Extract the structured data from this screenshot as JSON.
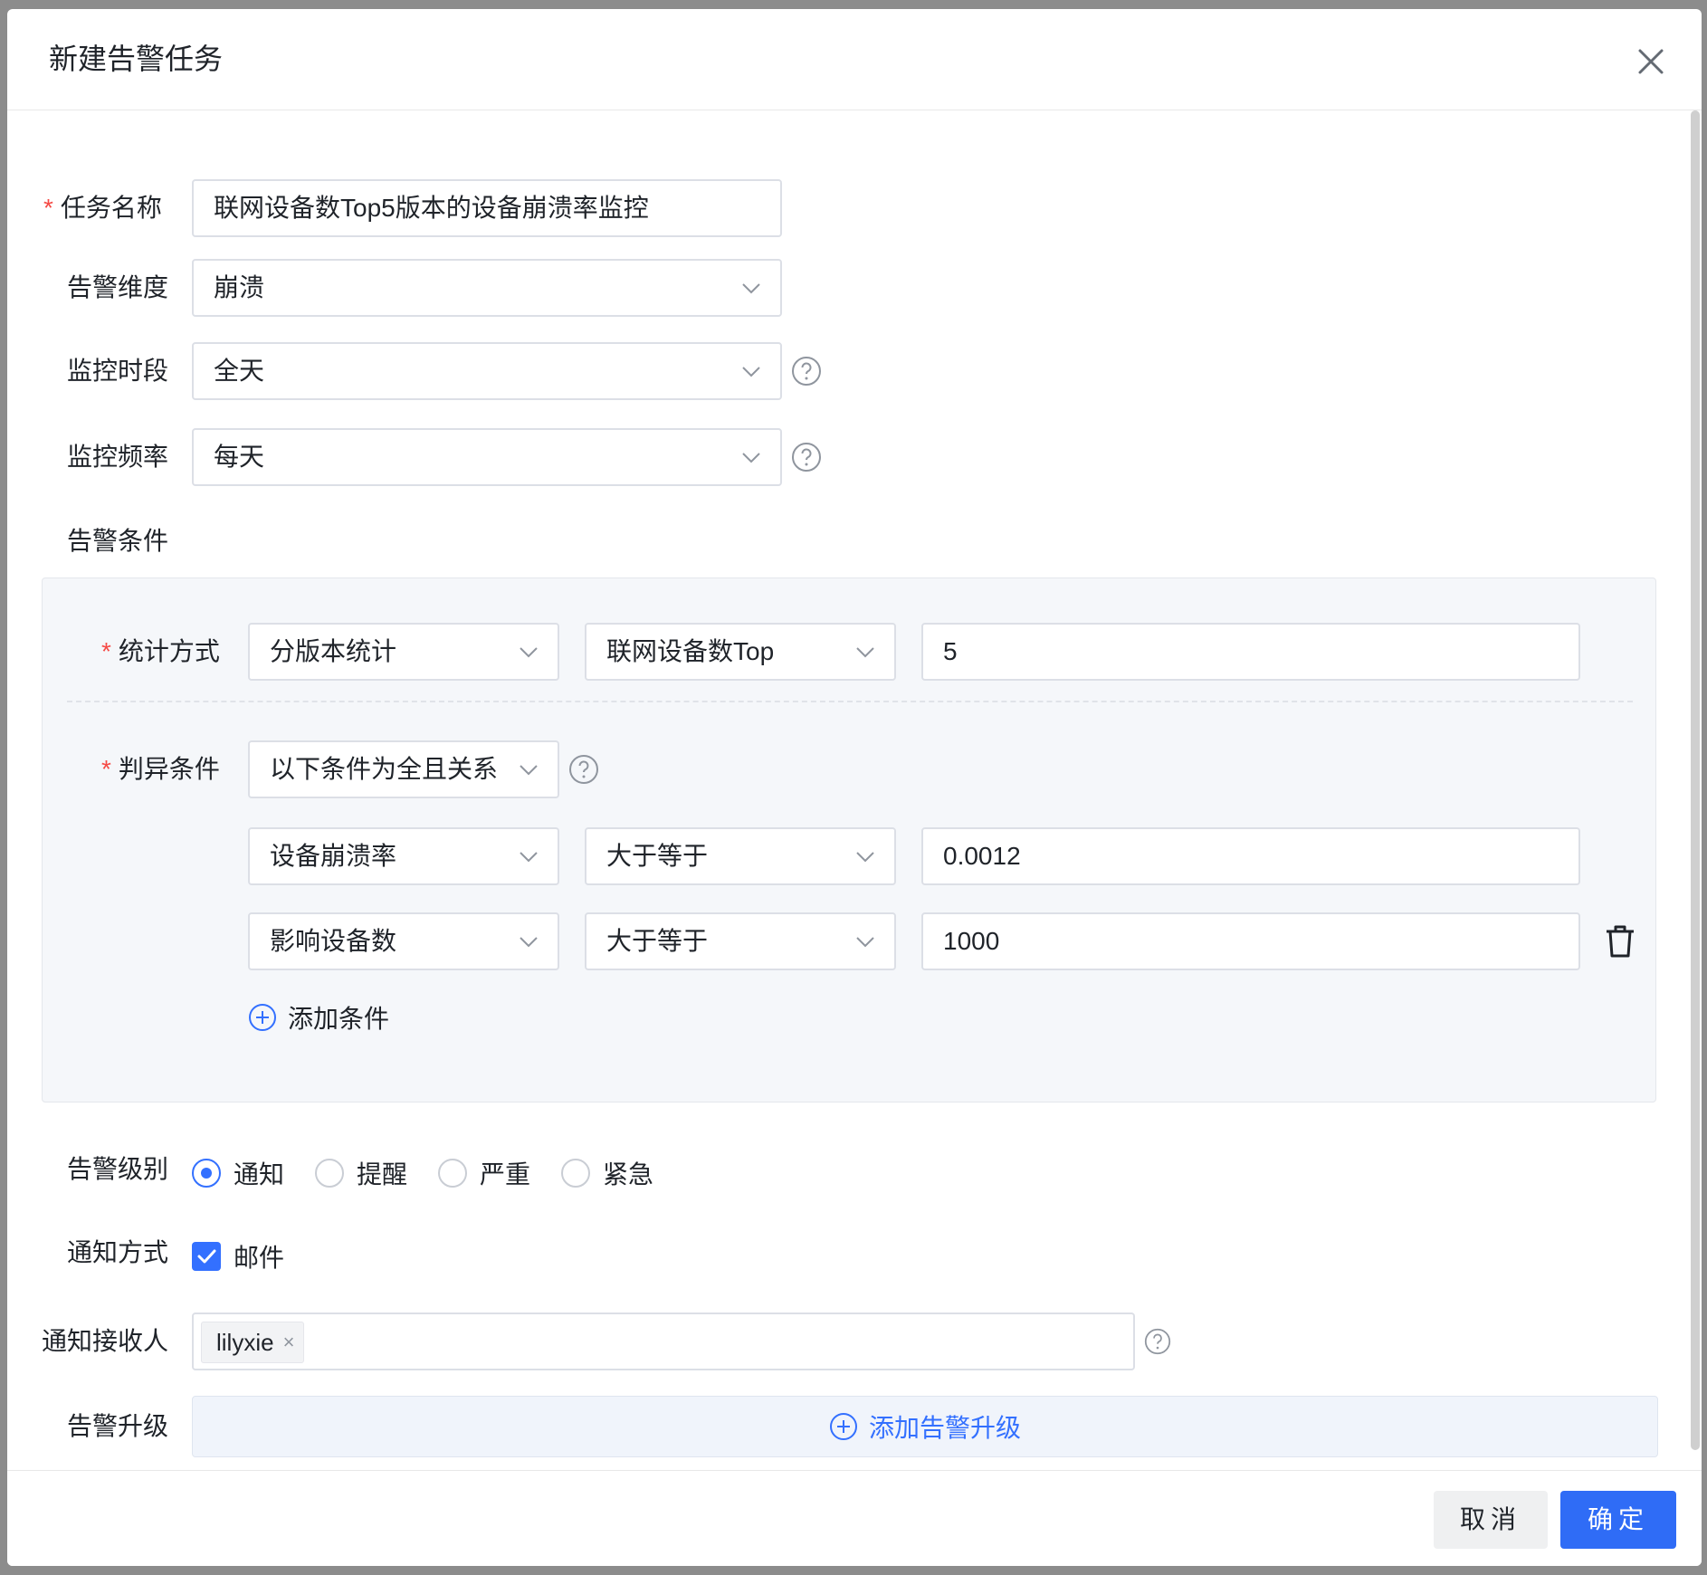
{
  "dialog": {
    "title": "新建告警任务"
  },
  "form": {
    "task_name": {
      "label": "任务名称",
      "required_mark": "*",
      "value": "联网设备数Top5版本的设备崩溃率监控"
    },
    "alert_dimension": {
      "label": "告警维度",
      "value": "崩溃"
    },
    "monitor_period": {
      "label": "监控时段",
      "value": "全天"
    },
    "monitor_frequency": {
      "label": "监控频率",
      "value": "每天"
    },
    "alert_condition": {
      "label": "告警条件",
      "stat_method": {
        "label": "统计方式",
        "required_mark": "*",
        "method": "分版本统计",
        "rank_by": "联网设备数Top",
        "top_n": "5"
      },
      "judge": {
        "label": "判异条件",
        "required_mark": "*",
        "relation": "以下条件为全且关系"
      },
      "rules": [
        {
          "metric": "设备崩溃率",
          "operator": "大于等于",
          "value": "0.0012"
        },
        {
          "metric": "影响设备数",
          "operator": "大于等于",
          "value": "1000"
        }
      ],
      "add_condition": "添加条件"
    },
    "alert_level": {
      "label": "告警级别",
      "options": [
        "通知",
        "提醒",
        "严重",
        "紧急"
      ],
      "selected": "通知"
    },
    "notify_method": {
      "label": "通知方式",
      "option": "邮件",
      "checked": true
    },
    "recipients": {
      "label": "通知接收人",
      "tags": [
        "lilyxie"
      ],
      "tag_remove": "×"
    },
    "escalation": {
      "label": "告警升级",
      "add_label": "添加告警升级"
    }
  },
  "footer": {
    "cancel_label": "取消",
    "confirm_label": "确定"
  },
  "colors": {
    "primary": "#3370ff",
    "confirm_button": "#2f6cf6",
    "required": "#f54a45",
    "panel_bg": "#f5f7fa"
  },
  "icons": {
    "close": "close-icon",
    "chevron": "chevron-down-icon",
    "help": "question-circle-icon",
    "delete": "trash-icon",
    "add": "plus-circle-icon",
    "check": "check-icon"
  }
}
